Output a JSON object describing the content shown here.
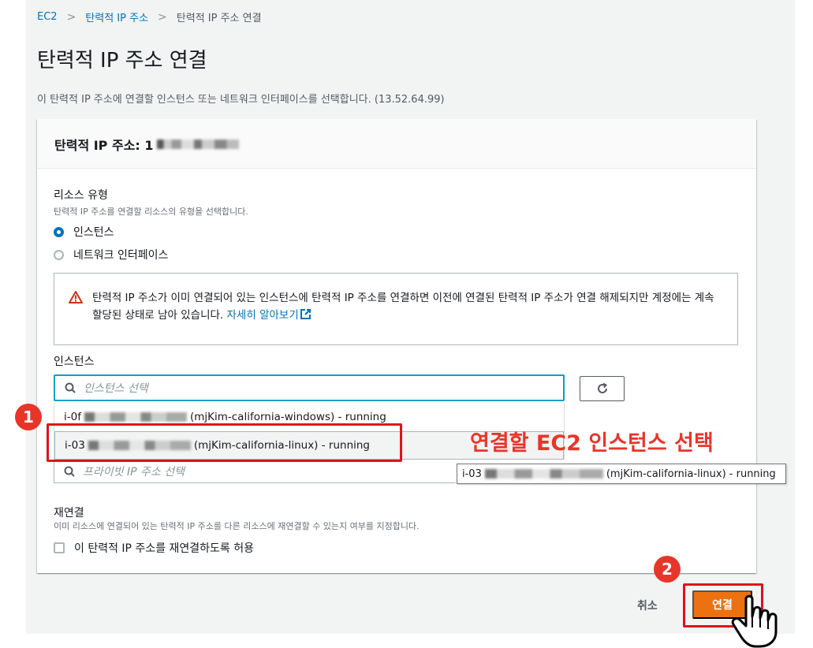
{
  "breadcrumb": {
    "root": "EC2",
    "parent": "탄력적 IP 주소",
    "current": "탄력적 IP 주소 연결"
  },
  "page": {
    "title": "탄력적 IP 주소 연결",
    "description": "이 탄력적 IP 주소에 연결할 인스턴스 또는 네트워크 인터페이스를 선택합니다. (13.52.64.99)"
  },
  "panel": {
    "title_prefix": "탄력적 IP 주소: 1",
    "resource_type": {
      "label": "리소스 유형",
      "description": "탄력적 IP 주소를 연결할 리소스의 유형을 선택합니다.",
      "options": [
        {
          "label": "인스턴스",
          "selected": true
        },
        {
          "label": "네트워크 인터페이스",
          "selected": false
        }
      ]
    },
    "alert": {
      "text": "탄력적 IP 주소가 이미 연결되어 있는 인스턴스에 탄력적 IP 주소를 연결하면 이전에 연결된 탄력적 IP 주소가 연결 해제되지만 계정에는 계속 할당된 상태로 남아 있습니다.",
      "link": "자세히 알아보기"
    },
    "instance": {
      "label": "인스턴스",
      "placeholder": "인스턴스 선택",
      "options": [
        {
          "id_prefix": "i-0f",
          "suffix": "(mjKim-california-windows) - running"
        },
        {
          "id_prefix": "i-03",
          "suffix": "(mjKim-california-linux) - running"
        }
      ]
    },
    "private_ip": {
      "placeholder": "프라이빗 IP 주소 선택"
    },
    "tooltip": {
      "id_prefix": "i-03",
      "suffix": "(mjKim-california-linux) - running"
    },
    "reassociation": {
      "label": "재연결",
      "description": "이미 리소스에 연결되어 있는 탄력적 IP 주소를 다른 리소스에 재연결할 수 있는지 여부를 지정합니다.",
      "checkbox_label": "이 탄력적 IP 주소를 재연결하도록 허용"
    }
  },
  "actions": {
    "cancel": "취소",
    "connect": "연결"
  },
  "annotations": {
    "step1": "1",
    "step2": "2",
    "callout": "연결할 EC2 인스턴스 선택"
  },
  "colors": {
    "accent": "#0073bb",
    "primary_button": "#ec7211",
    "annotation_red": "#e8352a",
    "focus": "#00a1c9"
  }
}
